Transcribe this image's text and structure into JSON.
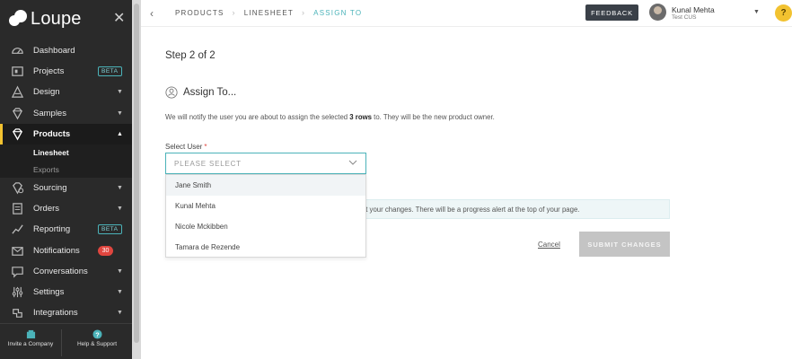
{
  "brand": {
    "name": "Loupe"
  },
  "sidebar": {
    "items": [
      {
        "label": "Dashboard",
        "icon": "dashboard-icon"
      },
      {
        "label": "Projects",
        "icon": "projects-icon",
        "badge": "BETA"
      },
      {
        "label": "Design",
        "icon": "design-icon",
        "caret": "▼"
      },
      {
        "label": "Samples",
        "icon": "samples-icon",
        "caret": "▼"
      },
      {
        "label": "Products",
        "icon": "products-icon",
        "caret": "▲"
      },
      {
        "label": "Sourcing",
        "icon": "sourcing-icon",
        "caret": "▼"
      },
      {
        "label": "Orders",
        "icon": "orders-icon",
        "caret": "▼"
      },
      {
        "label": "Reporting",
        "icon": "reporting-icon",
        "badge": "BETA"
      },
      {
        "label": "Notifications",
        "icon": "notifications-icon",
        "count": "30"
      },
      {
        "label": "Conversations",
        "icon": "conversations-icon",
        "caret": "▼"
      },
      {
        "label": "Settings",
        "icon": "settings-icon",
        "caret": "▼"
      },
      {
        "label": "Integrations",
        "icon": "integrations-icon",
        "caret": "▼"
      }
    ],
    "products_sub": [
      "Linesheet",
      "Exports"
    ],
    "footer": {
      "invite": "Invite a Company",
      "help": "Help & Support"
    }
  },
  "topbar": {
    "breadcrumbs": [
      "PRODUCTS",
      "LINESHEET",
      "ASSIGN TO"
    ],
    "feedback": "FEEDBACK",
    "user_name": "Kunal Mehta",
    "user_org": "Test CUS",
    "help": "?"
  },
  "main": {
    "step": "Step 2 of 2",
    "heading": "Assign To...",
    "notice_pre": "We will notify the user you are about to assign the selected ",
    "notice_bold": "3 rows",
    "notice_post": " to. They will be the new product owner.",
    "select_label": "Select User",
    "select_required": "*",
    "select_placeholder": "PLEASE SELECT",
    "options": [
      "Jane Smith",
      "Kunal Mehta",
      "Nicole Mckibben",
      "Tamara de Rezende"
    ],
    "info_text": "mit your changes. There will be a progress alert at the top of your page.",
    "cancel": "Cancel",
    "submit": "SUBMIT CHANGES"
  },
  "colors": {
    "accent": "#4bb3b9",
    "sidebar_bg": "#2a2a2a",
    "active_marker": "#f2c230",
    "badge_red": "#e0463f",
    "feedback_bg": "#3a4048"
  }
}
